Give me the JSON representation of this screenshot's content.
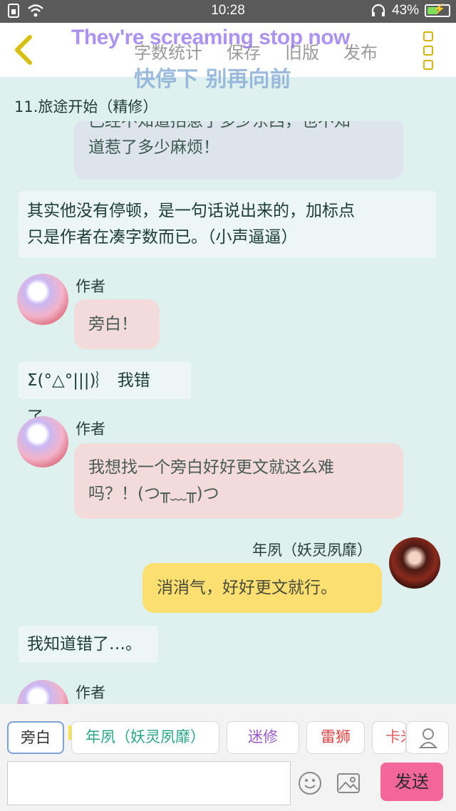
{
  "status_bar": {
    "time": "10:28",
    "battery": "43%"
  },
  "header": {
    "menu": [
      "字数统计",
      "保存",
      "旧版",
      "发布"
    ],
    "overlay_en": "They're screaming stop now",
    "overlay_zh": "快停下 别再向前"
  },
  "chapter_title": "11.旅途开始（精修）",
  "messages": {
    "m1_line1": "已经不知道招惹了多少东西，也不知",
    "m1_line2": "道惹了多少麻烦！",
    "n1_line1": "其实他没有停顿，是一句话说出来的，加标点",
    "n1_line2": "只是作者在凑字数而已。（小声逼逼）",
    "author_name": "作者",
    "a1": "旁白！",
    "n2": "Σ(°△°|||)︴ 我错了。",
    "a2_line1": "我想找一个旁白好好更文就这么难",
    "a2_line2": "吗？！(つ╥﹏╥)つ",
    "nian_name": "年夙（妖灵夙靡）",
    "y1": "消消气，好好更文就行。",
    "n3": "我知道错了…。"
  },
  "roles": {
    "host_badge": "主",
    "items": [
      "旁白",
      "年夙（妖灵夙靡）",
      "迷修",
      "雷狮",
      "卡米"
    ]
  },
  "input": {
    "placeholder": "",
    "send": "发送"
  },
  "colors": {
    "background": "#def1ee",
    "send": "#f3669a",
    "yellow_bubble": "#fbe071",
    "pink_bubble": "#f3dadb"
  },
  "icons": [
    "wifi-icon",
    "sim-icon",
    "headset-icon",
    "battery-icon",
    "back-arrow-icon",
    "more-icon",
    "person-icon",
    "emoji-icon",
    "image-icon"
  ]
}
